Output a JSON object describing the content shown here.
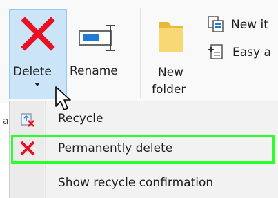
{
  "ribbon": {
    "delete_label": "Delete",
    "rename_label": "Rename",
    "new_folder_line1": "New",
    "new_folder_line2": "folder",
    "new_item_label": "New it",
    "easy_access_label": "Easy a"
  },
  "delete_menu": {
    "items": [
      {
        "label": "Recycle",
        "icon": "recycle-bin-icon"
      },
      {
        "label": "Permanently delete",
        "icon": "red-x-icon"
      },
      {
        "label": "Show recycle confirmation",
        "icon": ""
      }
    ]
  },
  "left_strip_text": "a",
  "colors": {
    "accent_pressed_bg": "#cce4f7",
    "accent_pressed_border": "#99c9ef",
    "delete_red": "#e81123",
    "highlight_green": "#2bff2b"
  }
}
